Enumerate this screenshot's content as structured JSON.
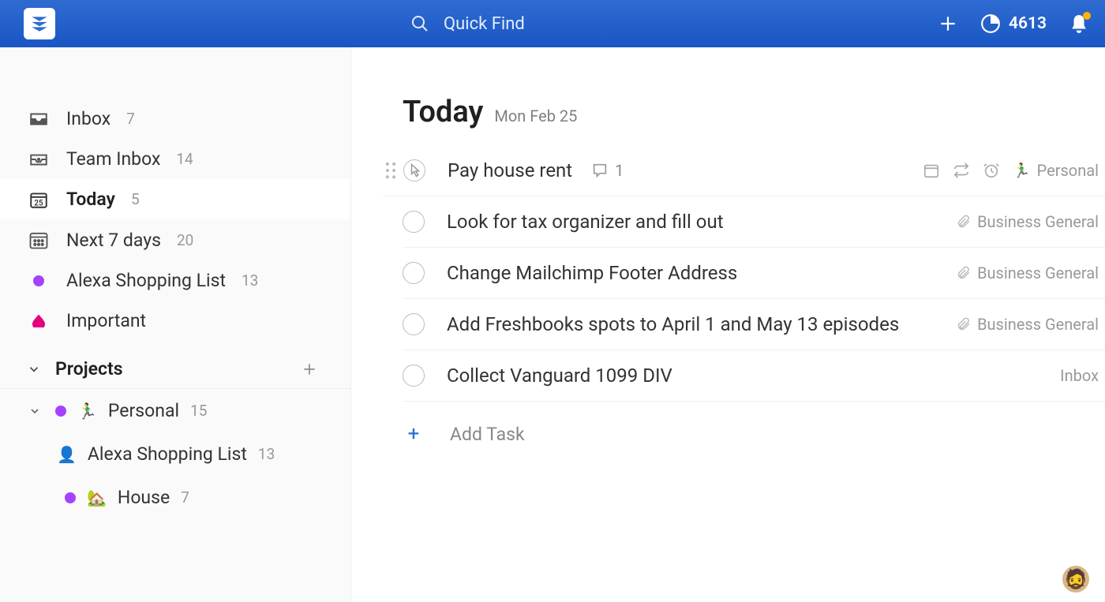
{
  "header": {
    "search_placeholder": "Quick Find",
    "karma_points": "4613"
  },
  "sidebar": {
    "inbox": {
      "label": "Inbox",
      "count": "7"
    },
    "team_inbox": {
      "label": "Team Inbox",
      "count": "14"
    },
    "today": {
      "label": "Today",
      "count": "5"
    },
    "next7": {
      "label": "Next 7 days",
      "count": "20"
    },
    "alexa": {
      "label": "Alexa Shopping List",
      "count": "13"
    },
    "important": {
      "label": "Important"
    },
    "projects_label": "Projects",
    "projects": {
      "personal": {
        "label": "Personal",
        "count": "15"
      },
      "alexa_list": {
        "label": "Alexa Shopping List",
        "count": "13"
      },
      "house": {
        "label": "House",
        "count": "7"
      }
    }
  },
  "main": {
    "title": "Today",
    "date": "Mon Feb 25",
    "tasks": [
      {
        "title": "Pay house rent",
        "comments": "1",
        "project": "Personal",
        "hover": true,
        "emoji": true
      },
      {
        "title": "Look for tax organizer and fill out",
        "project": "Business General",
        "clip": true
      },
      {
        "title": "Change Mailchimp Footer Address",
        "project": "Business General",
        "clip": true
      },
      {
        "title": "Add Freshbooks spots to April 1 and May 13 episodes",
        "project": "Business General",
        "clip": true
      },
      {
        "title": "Collect Vanguard 1099 DIV",
        "project": "Inbox"
      }
    ],
    "add_task_label": "Add Task"
  }
}
